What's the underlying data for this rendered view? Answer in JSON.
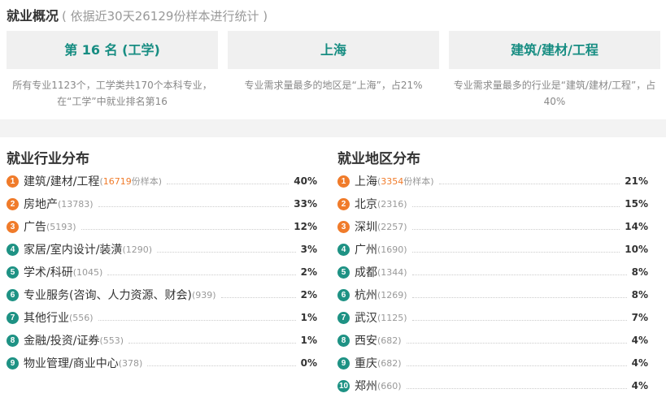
{
  "header": {
    "title": "就业概况",
    "subtitle": "( 依据近30天26129份样本进行统计 )"
  },
  "summary": [
    {
      "value": "第 16 名 (工学)",
      "desc": "所有专业1123个，工学类共170个本科专业，在“工学”中就业排名第16"
    },
    {
      "value": "上海",
      "desc": "专业需求量最多的地区是“上海”，占21%"
    },
    {
      "value": "建筑/建材/工程",
      "desc": "专业需求量最多的行业是“建筑/建材/工程”，占40%"
    }
  ],
  "industry": {
    "title": "就业行业分布",
    "items": [
      {
        "rank": "1",
        "name": "建筑/建材/工程",
        "count_open": "(",
        "count": "16719",
        "count_suffix": "份样本)",
        "pct": "40%"
      },
      {
        "rank": "2",
        "name": "房地产",
        "count": "(13783)",
        "pct": "33%"
      },
      {
        "rank": "3",
        "name": "广告",
        "count": "(5193)",
        "pct": "12%"
      },
      {
        "rank": "4",
        "name": "家居/室内设计/装潢",
        "count": "(1290)",
        "pct": "3%"
      },
      {
        "rank": "5",
        "name": "学术/科研",
        "count": "(1045)",
        "pct": "2%"
      },
      {
        "rank": "6",
        "name": "专业服务(咨询、人力资源、财会)",
        "count": "(939)",
        "pct": "2%"
      },
      {
        "rank": "7",
        "name": "其他行业",
        "count": "(556)",
        "pct": "1%"
      },
      {
        "rank": "8",
        "name": "金融/投资/证券",
        "count": "(553)",
        "pct": "1%"
      },
      {
        "rank": "9",
        "name": "物业管理/商业中心",
        "count": "(378)",
        "pct": "0%"
      }
    ]
  },
  "region": {
    "title": "就业地区分布",
    "items": [
      {
        "rank": "1",
        "name": "上海",
        "count_open": "(",
        "count": "3354",
        "count_suffix": "份样本)",
        "pct": "21%"
      },
      {
        "rank": "2",
        "name": "北京",
        "count": "(2316)",
        "pct": "15%"
      },
      {
        "rank": "3",
        "name": "深圳",
        "count": "(2257)",
        "pct": "14%"
      },
      {
        "rank": "4",
        "name": "广州",
        "count": "(1690)",
        "pct": "10%"
      },
      {
        "rank": "5",
        "name": "成都",
        "count": "(1344)",
        "pct": "8%"
      },
      {
        "rank": "6",
        "name": "杭州",
        "count": "(1269)",
        "pct": "8%"
      },
      {
        "rank": "7",
        "name": "武汉",
        "count": "(1125)",
        "pct": "7%"
      },
      {
        "rank": "8",
        "name": "西安",
        "count": "(682)",
        "pct": "4%"
      },
      {
        "rank": "9",
        "name": "重庆",
        "count": "(682)",
        "pct": "4%"
      },
      {
        "rank": "10",
        "name": "郑州",
        "count": "(660)",
        "pct": "4%"
      }
    ]
  },
  "colors": {
    "accent_teal": "#178d82",
    "badge_orange": "#f07b2a",
    "badge_teal": "#1e9284"
  }
}
